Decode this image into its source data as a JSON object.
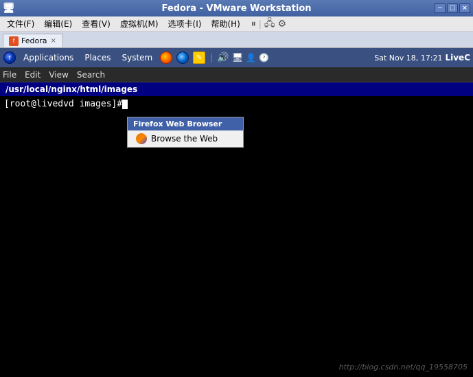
{
  "titlebar": {
    "title": "Fedora - VMware Workstation",
    "icon": "vmware-icon"
  },
  "menubar": {
    "items": [
      {
        "label": "文件(F)"
      },
      {
        "label": "编辑(E)"
      },
      {
        "label": "查看(V)"
      },
      {
        "label": "虚拟机(M)"
      },
      {
        "label": "选项卡(I)"
      },
      {
        "label": "帮助(H)"
      }
    ]
  },
  "toolbar": {
    "pause_icon": "pause-icon",
    "network_icon": "network-icon",
    "settings_icon": "settings-icon"
  },
  "tab": {
    "label": "Fedora",
    "close": "×"
  },
  "gnome_panel": {
    "apps_label": "Applications",
    "places_label": "Places",
    "system_label": "System",
    "clock": "Sat Nov 18, 17:21",
    "livec": "LiveC"
  },
  "dropdown": {
    "header": "Firefox Web Browser",
    "items": [
      {
        "label": "Browse the Web",
        "icon": "firefox-icon"
      }
    ]
  },
  "terminal": {
    "menu_items": [
      "File",
      "Edit",
      "View",
      "Search"
    ],
    "location": "/usr/local/nginx/html/images",
    "prompt": "[root@livedvd images]# "
  },
  "watermark": {
    "text": "http://blog.csdn.net/qq_19558705"
  }
}
